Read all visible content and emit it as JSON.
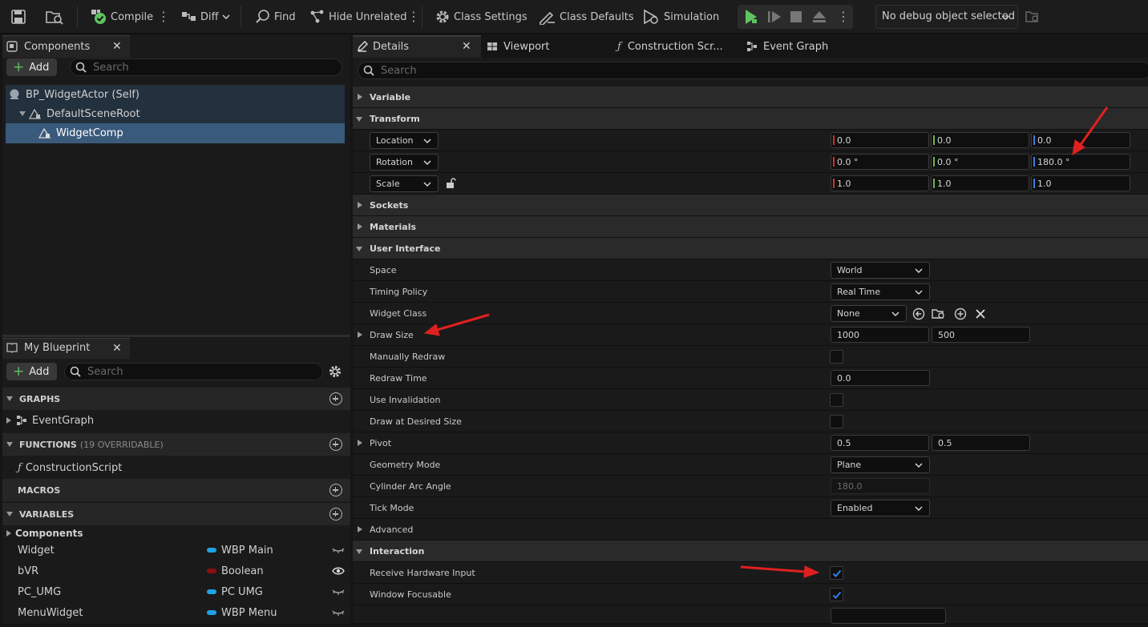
{
  "toolbar": {
    "compile": "Compile",
    "diff": "Diff",
    "find": "Find",
    "hide_unrelated": "Hide Unrelated",
    "class_settings": "Class Settings",
    "class_defaults": "Class Defaults",
    "simulation": "Simulation",
    "debug_object": "No debug object selected"
  },
  "components_panel": {
    "tab": "Components",
    "add": "Add",
    "search_placeholder": "Search",
    "tree": [
      "BP_WidgetActor (Self)",
      "DefaultSceneRoot",
      "WidgetComp"
    ]
  },
  "my_blueprint": {
    "tab": "My Blueprint",
    "add": "Add",
    "search_placeholder": "Search",
    "graphs": "GRAPHS",
    "event_graph": "EventGraph",
    "functions": "FUNCTIONS",
    "functions_note": "(19 OVERRIDABLE)",
    "construction_script": "ConstructionScript",
    "macros": "MACROS",
    "variables": "VARIABLES",
    "components_category": "Components",
    "vars": [
      {
        "name": "Widget",
        "type": "WBP Main",
        "color": "#1fa2e6"
      },
      {
        "name": "bVR",
        "type": "Boolean",
        "color": "#8c0e0e"
      },
      {
        "name": "PC_UMG",
        "type": "PC UMG",
        "color": "#1fa2e6"
      },
      {
        "name": "MenuWidget",
        "type": "WBP Menu",
        "color": "#1fa2e6"
      }
    ]
  },
  "tabs": {
    "details": "Details",
    "viewport": "Viewport",
    "construction": "Construction Scr...",
    "event_graph": "Event Graph"
  },
  "details": {
    "search_placeholder": "Search",
    "variable": "Variable",
    "transform": "Transform",
    "location": {
      "label": "Location",
      "x": "0.0",
      "y": "0.0",
      "z": "0.0"
    },
    "rotation": {
      "label": "Rotation",
      "x": "0.0 °",
      "y": "0.0 °",
      "z": "180.0 °"
    },
    "scale": {
      "label": "Scale",
      "x": "1.0",
      "y": "1.0",
      "z": "1.0"
    },
    "sockets": "Sockets",
    "materials": "Materials",
    "user_interface": "User Interface",
    "space": {
      "label": "Space",
      "value": "World"
    },
    "timing_policy": {
      "label": "Timing Policy",
      "value": "Real Time"
    },
    "widget_class": {
      "label": "Widget Class",
      "value": "None"
    },
    "draw_size": {
      "label": "Draw Size",
      "x": "1000",
      "y": "500"
    },
    "manually_redraw": {
      "label": "Manually Redraw",
      "checked": false
    },
    "redraw_time": {
      "label": "Redraw Time",
      "value": "0.0"
    },
    "use_invalidation": {
      "label": "Use Invalidation",
      "checked": false
    },
    "draw_at_desired_size": {
      "label": "Draw at Desired Size",
      "checked": false
    },
    "pivot": {
      "label": "Pivot",
      "x": "0.5",
      "y": "0.5"
    },
    "geometry_mode": {
      "label": "Geometry Mode",
      "value": "Plane"
    },
    "cylinder_arc_angle": {
      "label": "Cylinder Arc Angle",
      "value": "180.0"
    },
    "tick_mode": {
      "label": "Tick Mode",
      "value": "Enabled"
    },
    "advanced": "Advanced",
    "interaction": "Interaction",
    "receive_hardware_input": {
      "label": "Receive Hardware Input",
      "checked": true
    },
    "window_focusable": {
      "label": "Window Focusable",
      "checked": true
    }
  },
  "colors": {
    "accent_blue": "#1d6ad8",
    "annotation_red": "#e02020",
    "play_green": "#5fc35f"
  }
}
